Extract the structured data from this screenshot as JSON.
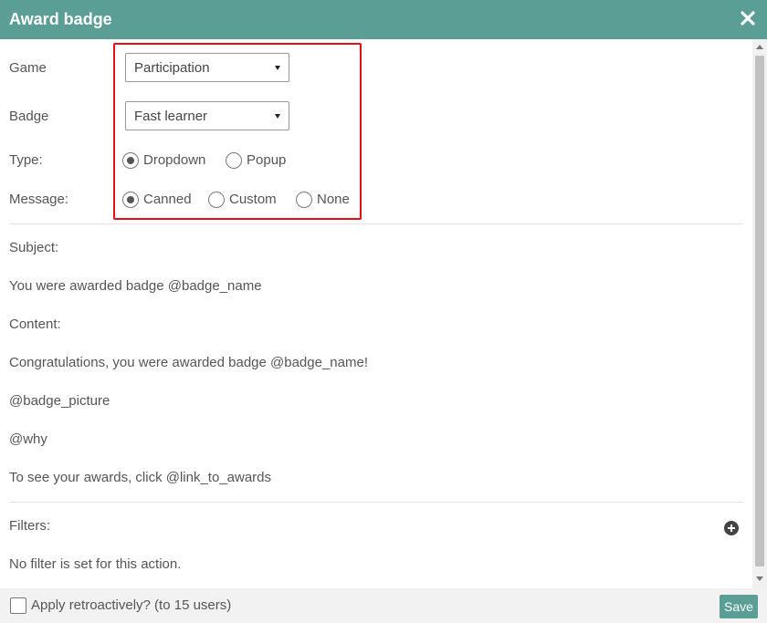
{
  "dialog": {
    "title": "Award badge",
    "close_icon": "close-icon"
  },
  "form": {
    "game": {
      "label": "Game",
      "selected": "Participation"
    },
    "badge": {
      "label": "Badge",
      "selected": "Fast learner"
    },
    "type": {
      "label": "Type:",
      "options": [
        "Dropdown",
        "Popup"
      ],
      "selected": "Dropdown"
    },
    "message": {
      "label": "Message:",
      "options": [
        "Canned",
        "Custom",
        "None"
      ],
      "selected": "Canned"
    }
  },
  "canned": {
    "subject_label": "Subject:",
    "subject": "You were awarded badge @badge_name",
    "content_label": "Content:",
    "content_lines": [
      "Congratulations, you were awarded badge @badge_name!",
      "@badge_picture",
      "@why",
      "To see your awards, click @link_to_awards"
    ]
  },
  "filters": {
    "label": "Filters:",
    "empty_text": "No filter is set for this action.",
    "add_icon": "plus-circle-icon"
  },
  "footer": {
    "retro_label": "Apply retroactively? (to 15 users)",
    "retro_checked": false,
    "save_label": "Save"
  },
  "colors": {
    "header": "#5b9e96",
    "highlight": "#e3101a",
    "save_button": "#5b9e96"
  }
}
